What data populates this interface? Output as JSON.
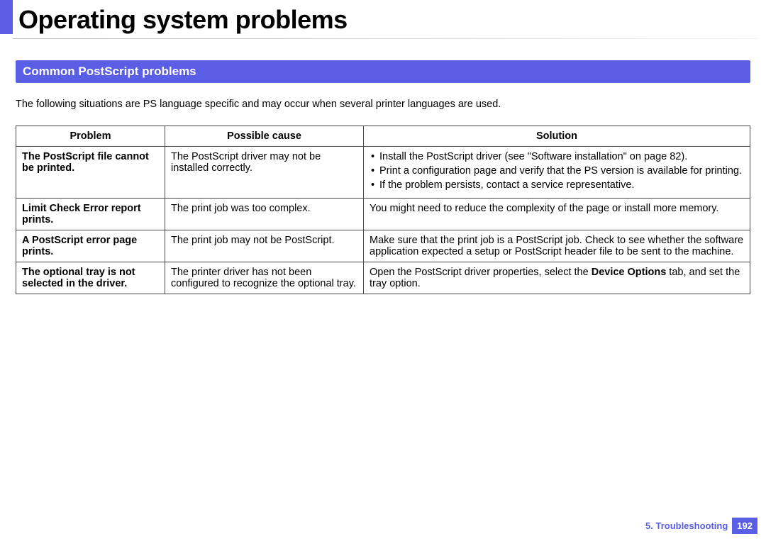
{
  "title": "Operating system problems",
  "section": "Common PostScript problems",
  "intro": "The following situations are PS language specific and may occur when several printer languages are used.",
  "headers": {
    "problem": "Problem",
    "cause": "Possible cause",
    "solution": "Solution"
  },
  "rows": [
    {
      "problem": "The PostScript file cannot be printed.",
      "cause": "The PostScript driver may not be installed correctly.",
      "solution_list": [
        "Install the PostScript driver (see \"Software installation\" on page 82).",
        "Print a configuration page and verify that the PS version is available for printing.",
        "If the problem persists, contact a service representative."
      ]
    },
    {
      "problem": "Limit Check Error report prints.",
      "cause": "The print job was too complex.",
      "solution_text": "You might need to reduce the complexity of the page or install more memory."
    },
    {
      "problem": "A PostScript error page prints.",
      "cause": "The print job may not be PostScript.",
      "solution_text": "Make sure that the print job is a PostScript job. Check to see whether the software application expected a setup or PostScript header file to be sent to the machine."
    },
    {
      "problem": "The optional tray is not selected in the driver.",
      "cause": "The printer driver has not been configured to recognize the optional tray.",
      "solution_rich": {
        "before": "Open the PostScript driver properties, select the ",
        "bold": "Device Options",
        "after": " tab, and set the tray option."
      }
    }
  ],
  "footer": {
    "chapter": "5.  Troubleshooting",
    "page": "192"
  }
}
